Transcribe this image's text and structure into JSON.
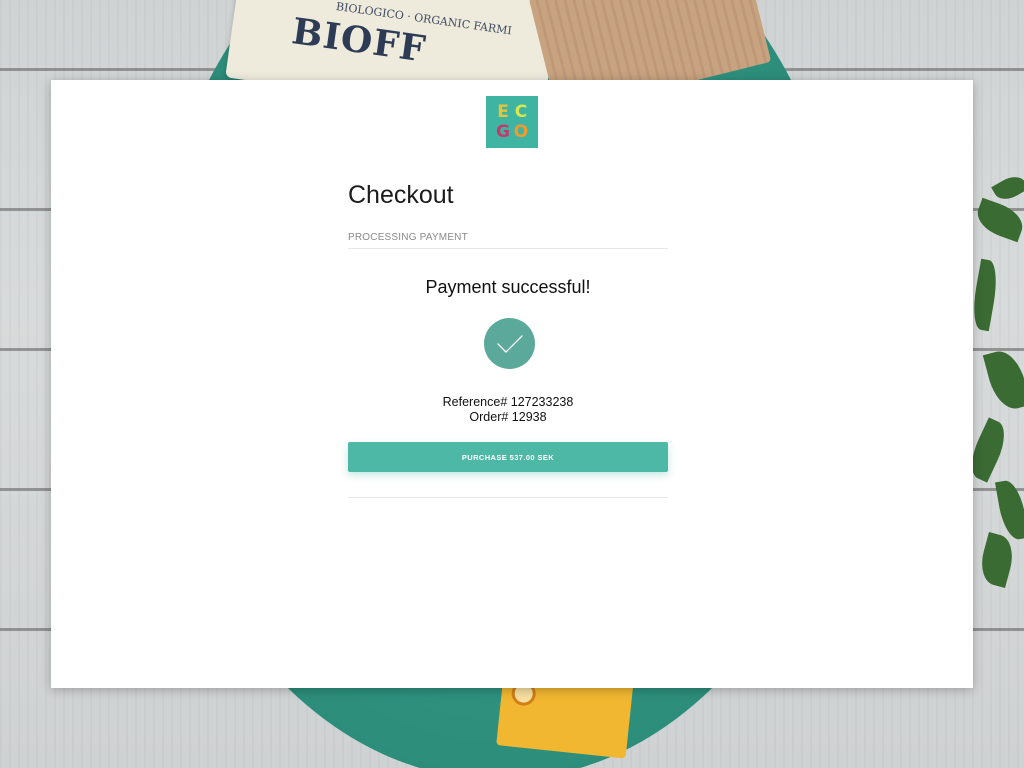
{
  "background": {
    "pack_brand": "BIOFF",
    "pack_tagline": "BIOLOGICO · ORGANIC FARMI"
  },
  "logo": {
    "letters": [
      "E",
      "C",
      "G",
      "O"
    ],
    "icon": "ecgo-logo"
  },
  "checkout": {
    "title": "Checkout",
    "step_label": "PROCESSING PAYMENT",
    "success_message": "Payment successful!",
    "success_icon": "checkmark-icon",
    "reference_line": "Reference# 127233238",
    "order_line": "Order# 12938",
    "purchase_button_label": "PURCHASE 537.00 SEK"
  },
  "colors": {
    "accent": "#4db8a6",
    "success_circle": "#5aa99b",
    "logo_bg": "#3fb4a2"
  }
}
